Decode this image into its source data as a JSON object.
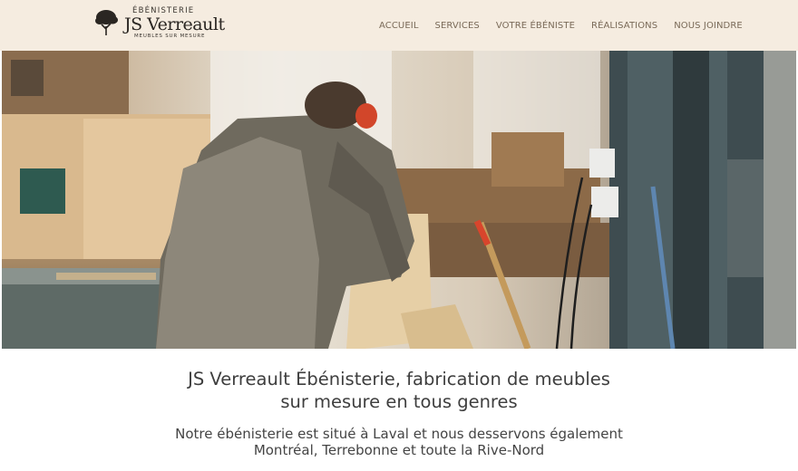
{
  "brand": {
    "top": "ÉBÉNISTERIE",
    "name": "JS Verreault",
    "tagline": "MEUBLES SUR MESURE"
  },
  "nav": {
    "items": [
      {
        "label": "ACCUEIL"
      },
      {
        "label": "SERVICES"
      },
      {
        "label": "VOTRE ÉBÉNISTE"
      },
      {
        "label": "RÉALISATIONS"
      },
      {
        "label": "NOUS JOINDRE"
      }
    ]
  },
  "hero": {
    "headline_line1": "JS Verreault Ébénisterie, fabrication de meubles",
    "headline_line2": "sur mesure en tous genres",
    "sub_line1": "Notre ébénisterie est situé à Laval et nous desservons également",
    "sub_line2": "Montréal, Terrebonne et toute la Rive-Nord"
  },
  "colors": {
    "header_bg": "#f5ece0",
    "nav_text": "#7a6a58",
    "body_text": "#3e3e3e"
  }
}
